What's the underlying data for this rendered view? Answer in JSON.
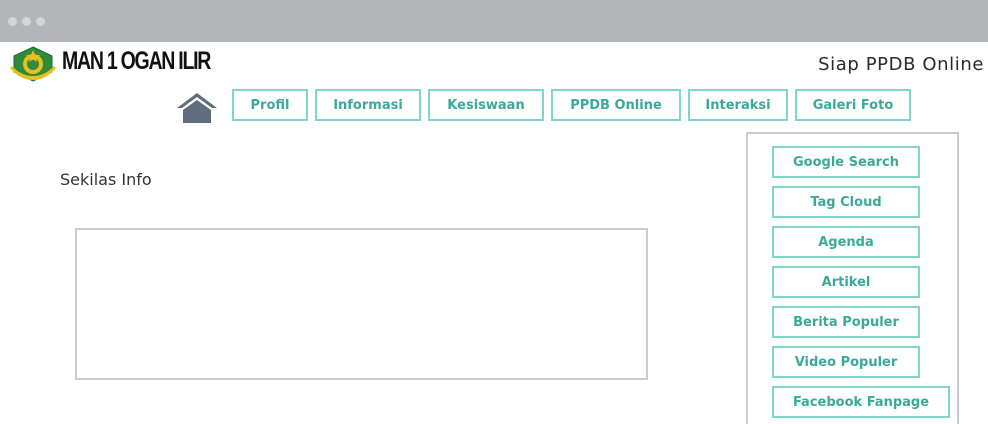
{
  "brand": {
    "name": "MAN 1 OGAN ILIR",
    "tagline": "Siap PPDB Online"
  },
  "nav": {
    "home_icon": "home-icon",
    "items": [
      "Profil",
      "Informasi",
      "Kesiswaan",
      "PPDB Online",
      "Interaksi",
      "Galeri Foto"
    ]
  },
  "main": {
    "section_title": "Sekilas Info"
  },
  "sidebar": {
    "items": [
      "Google Search",
      "Tag Cloud",
      "Agenda",
      "Artikel",
      "Berita Populer",
      "Video Populer",
      "Facebook Fanpage"
    ]
  },
  "colors": {
    "accent": "#3aaa97",
    "accent_border": "#82d6c7",
    "titlebar": "#b3b5b8",
    "logo_green": "#2e8b3a",
    "logo_gold": "#e8c01f"
  }
}
